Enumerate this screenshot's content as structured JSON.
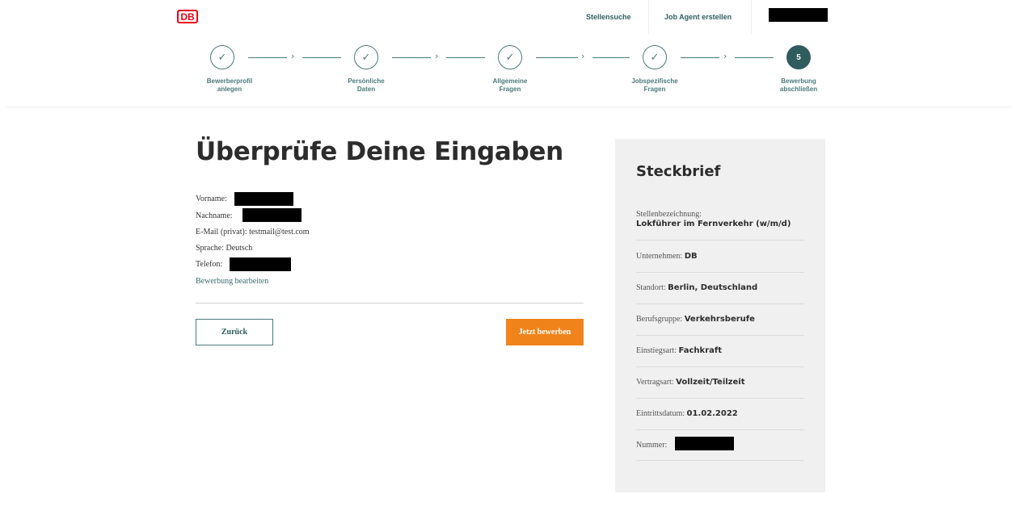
{
  "header": {
    "logo": "DB",
    "nav": {
      "jobsearch": "Stellensuche",
      "jobagent": "Job Agent erstellen"
    }
  },
  "stepper": {
    "steps": [
      {
        "line1": "Bewerberprofil",
        "line2": "anlegen",
        "state": "done",
        "mark": "✓"
      },
      {
        "line1": "Persönliche",
        "line2": "Daten",
        "state": "done",
        "mark": "✓"
      },
      {
        "line1": "Allgemeine",
        "line2": "Fragen",
        "state": "done",
        "mark": "✓"
      },
      {
        "line1": "Jobspezifische",
        "line2": "Fragen",
        "state": "done",
        "mark": "✓"
      },
      {
        "line1": "Bewerbung",
        "line2": "abschließen",
        "state": "active",
        "mark": "5"
      }
    ],
    "separator": "›"
  },
  "main": {
    "title": "Überprüfe Deine Eingaben",
    "fields": {
      "firstname_label": "Vorname:",
      "lastname_label": "Nachname:",
      "email": "E-Mail (privat): testmail@test.com",
      "language": "Sprache: Deutsch",
      "phone_label": "Telefon:"
    },
    "edit_link": "Bewerbung bearbeiten",
    "back_button": "Zurück",
    "apply_button": "Jetzt bewerben"
  },
  "profile": {
    "title": "Steckbrief",
    "job_title_label": "Stellenbezeichnung:",
    "job_title_value": "Lokführer im Fernverkehr (w/m/d)",
    "company_label": "Unternehmen:",
    "company_value": "DB",
    "location_label": "Standort:",
    "location_value": "Berlin, Deutschland",
    "group_label": "Berufsgruppe:",
    "group_value": "Verkehrsberufe",
    "entry_label": "Einstiegsart:",
    "entry_value": "Fachkraft",
    "contract_label": "Vertragsart:",
    "contract_value": "Vollzeit/Teilzeit",
    "start_label": "Eintrittsdatum:",
    "start_value": "01.02.2022",
    "number_label": "Nummer:"
  },
  "colors": {
    "brand_red": "#ec0016",
    "teal": "#2f5c5c",
    "accent_orange": "#f0841b",
    "panel_bg": "#f0f0f0"
  }
}
